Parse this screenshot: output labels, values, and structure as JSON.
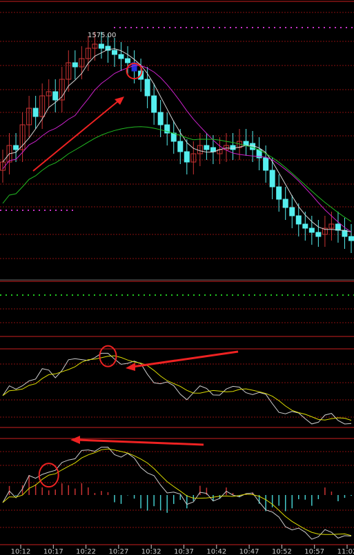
{
  "colors": {
    "background": "#000000",
    "border": "#cc2020",
    "grid": "#8a1010",
    "ref_dots_magenta": "#cc33cc",
    "ref_dots_green": "#22cc22",
    "candle_up": "#cc3333",
    "candle_down": "#55eeee",
    "ma_white": "#d8d8d8",
    "ma_magenta": "#cc22cc",
    "ma_green": "#22bb22",
    "osc_white": "#cfcfcf",
    "osc_yellow": "#dddd00",
    "hist_up": "#cc3333",
    "hist_down": "#44cccc",
    "annotation": "#ee2222",
    "highlight_candle": "#2233dd",
    "axis_text": "#cccccc"
  },
  "price_panel": {
    "high_label": "1575.00"
  },
  "time_axis": {
    "labels": [
      "10:12",
      "10:17",
      "10:22",
      "10:27",
      "10:32",
      "10:37",
      "10:42",
      "10:47",
      "10:52",
      "10:57",
      "11:02"
    ]
  },
  "chart_data": {
    "type": "candlestick",
    "panels": [
      {
        "name": "price",
        "ma_lines": [
          "white",
          "magenta",
          "green"
        ],
        "highlight_candle_index": 20
      },
      {
        "name": "oscillator_1",
        "lines": [
          "white",
          "yellow"
        ]
      },
      {
        "name": "oscillator_2_macd",
        "lines": [
          "white",
          "yellow"
        ],
        "histogram": true
      }
    ],
    "price_max_label": "1575.00",
    "candles_close_trend": [
      40,
      48,
      46,
      58,
      66,
      62,
      72,
      74,
      70,
      80,
      88,
      86,
      90,
      95,
      97,
      96,
      94,
      92,
      90,
      88,
      84,
      80,
      72,
      64,
      58,
      54,
      50,
      45,
      40,
      44,
      48,
      47,
      45,
      46,
      48,
      47,
      50,
      49,
      46,
      42,
      36,
      28,
      22,
      18,
      14,
      10,
      8,
      6,
      5,
      8,
      10,
      7,
      4,
      2
    ],
    "x_labels": [
      "10:12",
      "10:17",
      "10:22",
      "10:27",
      "10:32",
      "10:37",
      "10:42",
      "10:47",
      "10:52",
      "10:57",
      "11:02"
    ],
    "grid": true
  }
}
